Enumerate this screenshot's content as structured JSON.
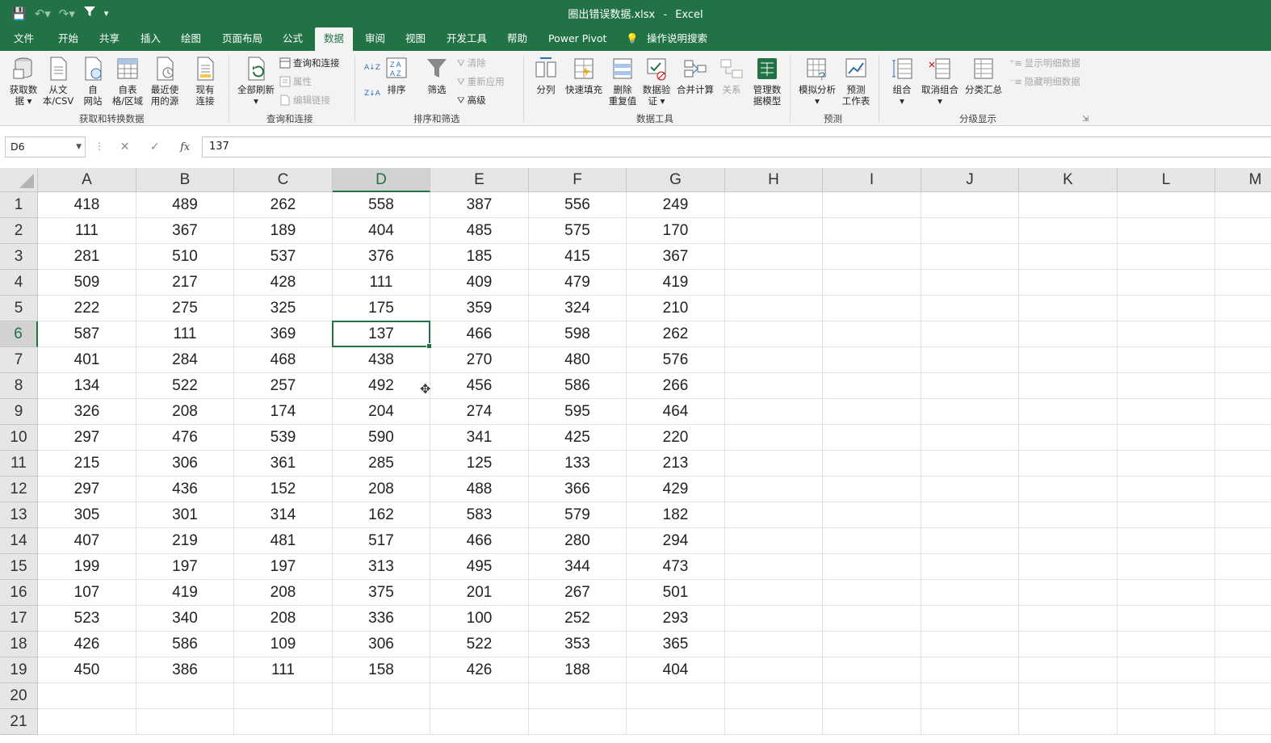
{
  "title_bar": {
    "filename": "圈出错误数据.xlsx",
    "separator": "-",
    "app": "Excel"
  },
  "tabs": [
    {
      "label": "文件",
      "active": false
    },
    {
      "label": "开始",
      "active": false
    },
    {
      "label": "共享",
      "active": false
    },
    {
      "label": "插入",
      "active": false
    },
    {
      "label": "绘图",
      "active": false
    },
    {
      "label": "页面布局",
      "active": false
    },
    {
      "label": "公式",
      "active": false
    },
    {
      "label": "数据",
      "active": true
    },
    {
      "label": "审阅",
      "active": false
    },
    {
      "label": "视图",
      "active": false
    },
    {
      "label": "开发工具",
      "active": false
    },
    {
      "label": "帮助",
      "active": false
    },
    {
      "label": "Power Pivot",
      "active": false
    },
    {
      "label": "操作说明搜索",
      "active": false
    }
  ],
  "ribbon": {
    "get_data": "获取数\n据 ▾",
    "from_csv": "从文\n本/CSV",
    "from_web": "自\n网站",
    "from_table": "自表\n格/区域",
    "recent_sources": "最近使\n用的源",
    "existing_conn": "现有\n连接",
    "group_get": "获取和转换数据",
    "refresh_all": "全部刷新\n▾",
    "queries_conn": "查询和连接",
    "properties": "属性",
    "edit_links": "编辑链接",
    "group_queries": "查询和连接",
    "sort_az": "A↓Z",
    "sort_za": "Z↓A",
    "sort": "排序",
    "filter": "筛选",
    "clear": "清除",
    "reapply": "重新应用",
    "advanced": "高级",
    "group_sort": "排序和筛选",
    "text_to_col": "分列",
    "flash_fill": "快速填充",
    "remove_dup": "删除\n重复值",
    "data_valid": "数据验\n证 ▾",
    "consolidate": "合并计算",
    "relationships": "关系",
    "manage_model": "管理数\n据模型",
    "group_tools": "数据工具",
    "what_if": "模拟分析\n▾",
    "forecast_sheet": "预测\n工作表",
    "group_forecast": "预测",
    "group_btn": "组合\n▾",
    "ungroup": "取消组合\n▾",
    "subtotal": "分类汇总",
    "show_detail": "显示明细数据",
    "hide_detail": "隐藏明细数据",
    "group_outline": "分级显示"
  },
  "formula_bar": {
    "name_box": "D6",
    "cancel": "✕",
    "enter": "✓",
    "fx": "fx",
    "formula": "137"
  },
  "columns": [
    "A",
    "B",
    "C",
    "D",
    "E",
    "F",
    "G",
    "H",
    "I",
    "J",
    "K",
    "L",
    "M"
  ],
  "selected_column": "D",
  "selected_row": 6,
  "rows": [
    {
      "n": "1",
      "v": [
        "418",
        "489",
        "262",
        "558",
        "387",
        "556",
        "249"
      ]
    },
    {
      "n": "2",
      "v": [
        "111",
        "367",
        "189",
        "404",
        "485",
        "575",
        "170"
      ]
    },
    {
      "n": "3",
      "v": [
        "281",
        "510",
        "537",
        "376",
        "185",
        "415",
        "367"
      ]
    },
    {
      "n": "4",
      "v": [
        "509",
        "217",
        "428",
        "111",
        "409",
        "479",
        "419"
      ]
    },
    {
      "n": "5",
      "v": [
        "222",
        "275",
        "325",
        "175",
        "359",
        "324",
        "210"
      ]
    },
    {
      "n": "6",
      "v": [
        "587",
        "111",
        "369",
        "137",
        "466",
        "598",
        "262"
      ]
    },
    {
      "n": "7",
      "v": [
        "401",
        "284",
        "468",
        "438",
        "270",
        "480",
        "576"
      ]
    },
    {
      "n": "8",
      "v": [
        "134",
        "522",
        "257",
        "492",
        "456",
        "586",
        "266"
      ]
    },
    {
      "n": "9",
      "v": [
        "326",
        "208",
        "174",
        "204",
        "274",
        "595",
        "464"
      ]
    },
    {
      "n": "10",
      "v": [
        "297",
        "476",
        "539",
        "590",
        "341",
        "425",
        "220"
      ]
    },
    {
      "n": "11",
      "v": [
        "215",
        "306",
        "361",
        "285",
        "125",
        "133",
        "213"
      ]
    },
    {
      "n": "12",
      "v": [
        "297",
        "436",
        "152",
        "208",
        "488",
        "366",
        "429"
      ]
    },
    {
      "n": "13",
      "v": [
        "305",
        "301",
        "314",
        "162",
        "583",
        "579",
        "182"
      ]
    },
    {
      "n": "14",
      "v": [
        "407",
        "219",
        "481",
        "517",
        "466",
        "280",
        "294"
      ]
    },
    {
      "n": "15",
      "v": [
        "199",
        "197",
        "197",
        "313",
        "495",
        "344",
        "473"
      ]
    },
    {
      "n": "16",
      "v": [
        "107",
        "419",
        "208",
        "375",
        "201",
        "267",
        "501"
      ]
    },
    {
      "n": "17",
      "v": [
        "523",
        "340",
        "208",
        "336",
        "100",
        "252",
        "293"
      ]
    },
    {
      "n": "18",
      "v": [
        "426",
        "586",
        "109",
        "306",
        "522",
        "353",
        "365"
      ]
    },
    {
      "n": "19",
      "v": [
        "450",
        "386",
        "111",
        "158",
        "426",
        "188",
        "404"
      ]
    },
    {
      "n": "20",
      "v": []
    },
    {
      "n": "21",
      "v": []
    }
  ],
  "colors": {
    "excel_green": "#217346",
    "ribbon_bg": "#f3f3f3",
    "header_bg": "#e6e6e6"
  }
}
